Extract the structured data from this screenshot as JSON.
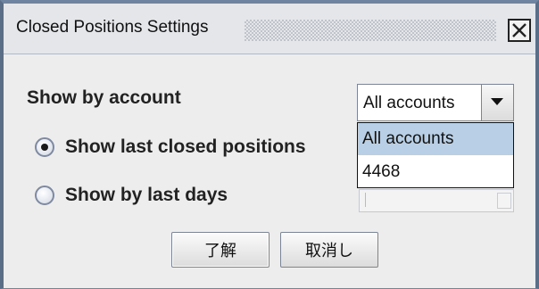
{
  "window": {
    "title": "Closed Positions Settings",
    "close_icon": "close-icon"
  },
  "form": {
    "show_by_account_label": "Show by account",
    "account_combo": {
      "selected": "All accounts",
      "options": [
        "All accounts",
        "4468"
      ],
      "highlighted": "All accounts"
    },
    "radios": [
      {
        "label": "Show last closed positions",
        "checked": true
      },
      {
        "label": "Show by last days",
        "checked": false
      }
    ]
  },
  "buttons": {
    "ok_label": "了解",
    "cancel_label": "取消し"
  },
  "colors": {
    "window_border": "#5a6f87",
    "dialog_bg": "#ededed",
    "selection": "#b8cfe5"
  }
}
